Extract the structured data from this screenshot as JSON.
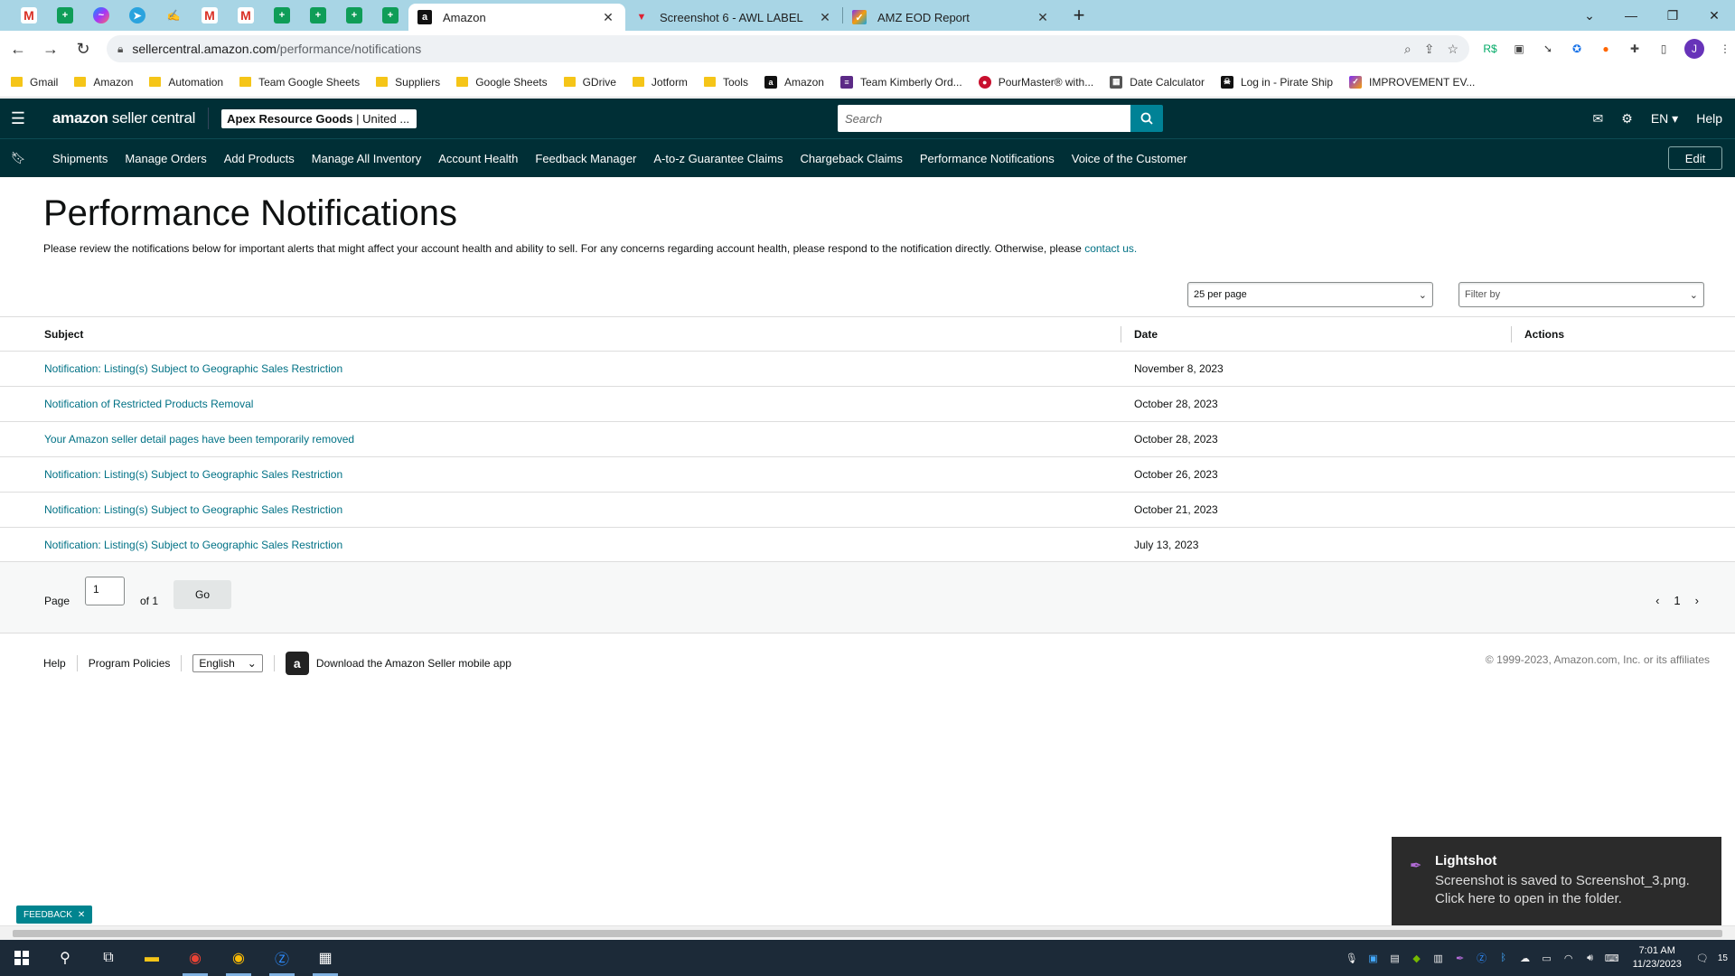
{
  "browser": {
    "tabs": [
      {
        "title": "Amazon",
        "active": true
      },
      {
        "title": "Screenshot 6 - AWL LABEL",
        "active": false
      },
      {
        "title": "AMZ EOD Report",
        "active": false
      }
    ],
    "url_host": "sellercentral.amazon.com",
    "url_path": "/performance/notifications",
    "bookmarks": [
      {
        "label": "Gmail",
        "icon": "gmail-icon"
      },
      {
        "label": "Amazon",
        "icon": "folder-icon"
      },
      {
        "label": "Automation",
        "icon": "folder-icon"
      },
      {
        "label": "Team Google Sheets",
        "icon": "folder-icon"
      },
      {
        "label": "Suppliers",
        "icon": "folder-icon"
      },
      {
        "label": "Google Sheets",
        "icon": "folder-icon"
      },
      {
        "label": "GDrive",
        "icon": "folder-icon"
      },
      {
        "label": "Jotform",
        "icon": "folder-icon"
      },
      {
        "label": "Tools",
        "icon": "folder-icon"
      },
      {
        "label": "Amazon",
        "icon": "amazon-icon"
      },
      {
        "label": "Team Kimberly Ord...",
        "icon": "list-icon"
      },
      {
        "label": "PourMaster® with...",
        "icon": "pourmaster-icon"
      },
      {
        "label": "Date Calculator",
        "icon": "calculator-icon"
      },
      {
        "label": "Log in - Pirate Ship",
        "icon": "pirate-ship-icon"
      },
      {
        "label": "IMPROVEMENT EV...",
        "icon": "clickup-icon"
      }
    ],
    "avatar_letter": "J"
  },
  "header": {
    "brand_bold": "amazon",
    "brand_light": " seller central",
    "account_bold": "Apex Resource Goods",
    "account_rest": " | United ...",
    "search_placeholder": "Search",
    "lang": "EN",
    "help": "Help"
  },
  "nav": {
    "items": [
      "Shipments",
      "Manage Orders",
      "Add Products",
      "Manage All Inventory",
      "Account Health",
      "Feedback Manager",
      "A-to-z Guarantee Claims",
      "Chargeback Claims",
      "Performance Notifications",
      "Voice of the Customer"
    ],
    "edit": "Edit"
  },
  "page": {
    "title": "Performance Notifications",
    "description": "Please review the notifications below for important alerts that might affect your account health and ability to sell. For any concerns regarding account health, please respond to the notification directly. Otherwise, please ",
    "contact_link": "contact us.",
    "per_page": "25 per page",
    "filter_placeholder": "Filter by"
  },
  "table": {
    "headers": {
      "subject": "Subject",
      "date": "Date",
      "actions": "Actions"
    },
    "rows": [
      {
        "subject": "Notification: Listing(s) Subject to Geographic Sales Restriction",
        "date": "November 8, 2023"
      },
      {
        "subject": "Notification of Restricted Products Removal",
        "date": "October 28, 2023"
      },
      {
        "subject": "Your Amazon seller detail pages have been temporarily removed",
        "date": "October 28, 2023"
      },
      {
        "subject": "Notification: Listing(s) Subject to Geographic Sales Restriction",
        "date": "October 26, 2023"
      },
      {
        "subject": "Notification: Listing(s) Subject to Geographic Sales Restriction",
        "date": "October 21, 2023"
      },
      {
        "subject": "Notification: Listing(s) Subject to Geographic Sales Restriction",
        "date": "July 13, 2023"
      }
    ]
  },
  "pager": {
    "page_label": "Page",
    "page_value": "1",
    "of_label": "of 1",
    "go": "Go",
    "current": "1"
  },
  "footer": {
    "help": "Help",
    "policies": "Program Policies",
    "language": "English",
    "app": "Download the Amazon Seller mobile app",
    "copyright": "© 1999-2023, Amazon.com, Inc. or its affiliates"
  },
  "feedback": "FEEDBACK",
  "toast": {
    "title": "Lightshot",
    "line1": "Screenshot is saved to Screenshot_3.png.",
    "line2": "Click here to open in the folder."
  },
  "taskbar": {
    "time": "7:01 AM",
    "date": "11/23/2023",
    "notifications": "15"
  },
  "colors": {
    "header_bg": "#002f36",
    "link": "#007185",
    "search_btn": "#008296",
    "tabstrip": "#a8d5e5"
  }
}
